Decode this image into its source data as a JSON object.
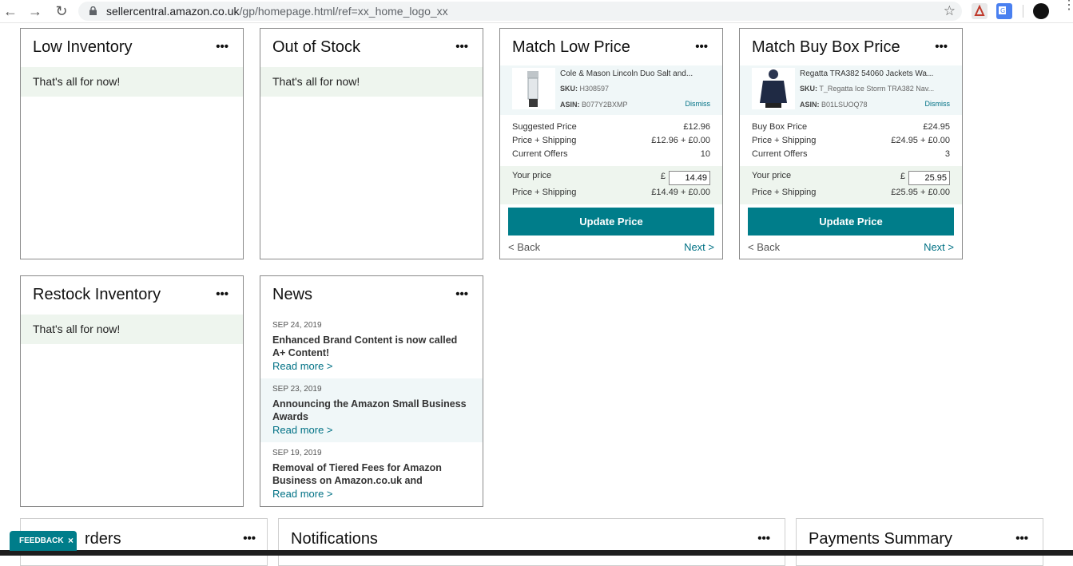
{
  "browser": {
    "url_host": "sellercentral.amazon.co.uk",
    "url_path": "/gp/homepage.html/ref=xx_home_logo_xx"
  },
  "cards": {
    "low_inventory": {
      "title": "Low Inventory",
      "menu": "•••",
      "empty": "That's all for now!"
    },
    "out_of_stock": {
      "title": "Out of Stock",
      "menu": "•••",
      "empty": "That's all for now!"
    },
    "match_low_price": {
      "title": "Match Low Price",
      "menu": "•••",
      "product_name": "Cole & Mason Lincoln Duo Salt and...",
      "sku_label": "SKU:",
      "sku": "H308597",
      "asin_label": "ASIN:",
      "asin": "B077Y2BXMP",
      "dismiss": "Dismiss",
      "rows": [
        {
          "label": "Suggested Price",
          "value": "£12.96"
        },
        {
          "label": "Price + Shipping",
          "value": "£12.96 + £0.00"
        },
        {
          "label": "Current Offers",
          "value": "10"
        }
      ],
      "your_price_label": "Your price",
      "currency": "£",
      "your_price": "14.49",
      "your_ship_label": "Price + Shipping",
      "your_ship_value": "£14.49 + £0.00",
      "update": "Update Price",
      "back": "< Back",
      "next": "Next >"
    },
    "match_buy_box": {
      "title": "Match Buy Box Price",
      "menu": "•••",
      "product_name": "Regatta TRA382 54060 Jackets Wa...",
      "sku_label": "SKU:",
      "sku": "T_Regatta Ice Storm TRA382 Nav...",
      "asin_label": "ASIN:",
      "asin": "B01LSUOQ78",
      "dismiss": "Dismiss",
      "rows": [
        {
          "label": "Buy Box Price",
          "value": "£24.95"
        },
        {
          "label": "Price + Shipping",
          "value": "£24.95 + £0.00"
        },
        {
          "label": "Current Offers",
          "value": "3"
        }
      ],
      "your_price_label": "Your price",
      "currency": "£",
      "your_price": "25.95",
      "your_ship_label": "Price + Shipping",
      "your_ship_value": "£25.95 + £0.00",
      "update": "Update Price",
      "back": "< Back",
      "next": "Next >"
    },
    "restock": {
      "title": "Restock Inventory",
      "menu": "•••",
      "empty": "That's all for now!"
    },
    "news": {
      "title": "News",
      "menu": "•••",
      "items": [
        {
          "date": "SEP 24, 2019",
          "headline": "Enhanced Brand Content is now called A+ Content!",
          "read": "Read more >"
        },
        {
          "date": "SEP 23, 2019",
          "headline": "Announcing the Amazon Small Business Awards",
          "read": "Read more >"
        },
        {
          "date": "SEP 19, 2019",
          "headline": "Removal of Tiered Fees for Amazon Business on Amazon.co.uk and",
          "read": "Read more >"
        }
      ]
    },
    "orders": {
      "title": "rders",
      "menu": "•••"
    },
    "notifications": {
      "title": "Notifications",
      "menu": "•••"
    },
    "payments": {
      "title": "Payments Summary",
      "menu": "•••"
    }
  },
  "feedback": {
    "label": "FEEDBACK",
    "close": "×"
  },
  "colors": {
    "accent": "#007d8a",
    "link": "#007185",
    "band": "#eef5ee"
  }
}
